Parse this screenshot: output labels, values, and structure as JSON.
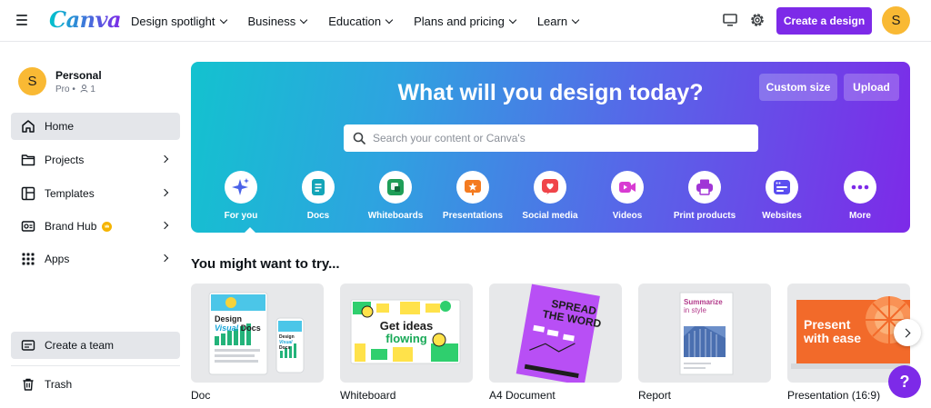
{
  "app": {
    "logo": "Canva",
    "accent": "#7d2ae8"
  },
  "nav": {
    "links": [
      "Design spotlight",
      "Business",
      "Education",
      "Plans and pricing",
      "Learn"
    ],
    "create_label": "Create a design",
    "avatar_initial": "S"
  },
  "sidebar": {
    "profile": {
      "initial": "S",
      "name": "Personal",
      "plan": "Pro",
      "members": "1"
    },
    "items": [
      {
        "label": "Home"
      },
      {
        "label": "Projects"
      },
      {
        "label": "Templates"
      },
      {
        "label": "Brand Hub"
      },
      {
        "label": "Apps"
      }
    ],
    "create_team_label": "Create a team",
    "trash_label": "Trash"
  },
  "hero": {
    "title": "What will you design today?",
    "custom_size_label": "Custom size",
    "upload_label": "Upload",
    "search_placeholder": "Search your content or Canva's",
    "categories": [
      {
        "label": "For you",
        "icon": "sparkle-icon",
        "color": "#4a62e8"
      },
      {
        "label": "Docs",
        "icon": "doc-icon",
        "color": "#13a5b8"
      },
      {
        "label": "Whiteboards",
        "icon": "whiteboard-icon",
        "color": "#1f9e58"
      },
      {
        "label": "Presentations",
        "icon": "presentation-icon",
        "color": "#f47b20"
      },
      {
        "label": "Social media",
        "icon": "heart-icon",
        "color": "#f0454a"
      },
      {
        "label": "Videos",
        "icon": "video-icon",
        "color": "#d83bd2"
      },
      {
        "label": "Print products",
        "icon": "printer-icon",
        "color": "#a035d6"
      },
      {
        "label": "Websites",
        "icon": "website-icon",
        "color": "#5b4ef0"
      },
      {
        "label": "More",
        "icon": "more-icon",
        "color": "#7d2ae8"
      }
    ]
  },
  "suggestions": {
    "title": "You might want to try...",
    "items": [
      {
        "label": "Doc",
        "thumb_text": [
          "Design",
          "Visual",
          "Docs"
        ]
      },
      {
        "label": "Whiteboard",
        "thumb_text": [
          "Get ideas",
          "flowing"
        ]
      },
      {
        "label": "A4 Document",
        "thumb_text": [
          "SPREAD",
          "THE WORD"
        ]
      },
      {
        "label": "Report",
        "thumb_text": [
          "Summarize",
          "in style"
        ]
      },
      {
        "label": "Presentation (16:9)",
        "thumb_text": [
          "Present",
          "with ease"
        ]
      }
    ]
  },
  "help_label": "?"
}
